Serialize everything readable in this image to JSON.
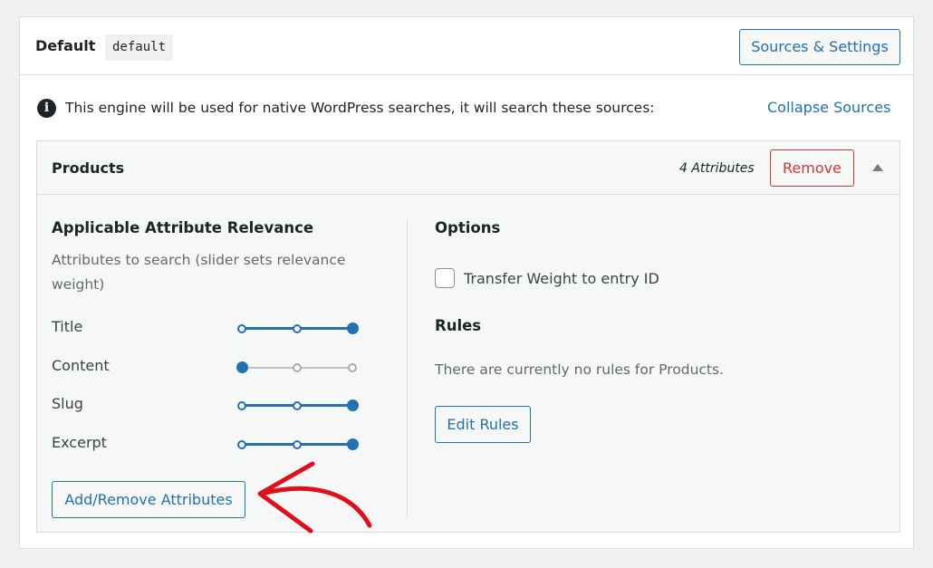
{
  "engine": {
    "name": "Default",
    "slug": "default",
    "sources_button": "Sources & Settings",
    "notice": "This engine will be used for native WordPress searches, it will search these sources:",
    "collapse_link": "Collapse Sources"
  },
  "source": {
    "name": "Products",
    "attribute_count": "4 Attributes",
    "remove_button": "Remove",
    "relevance": {
      "title": "Applicable Attribute Relevance",
      "description": "Attributes to search (slider sets relevance weight)",
      "attributes": [
        {
          "label": "Title",
          "weight_level": 3,
          "max_level": 3
        },
        {
          "label": "Content",
          "weight_level": 1,
          "max_level": 3
        },
        {
          "label": "Slug",
          "weight_level": 3,
          "max_level": 3
        },
        {
          "label": "Excerpt",
          "weight_level": 3,
          "max_level": 3
        }
      ],
      "add_remove_button": "Add/Remove Attributes"
    },
    "options": {
      "title": "Options",
      "transfer_weight_label": "Transfer Weight to entry ID",
      "transfer_weight_checked": false
    },
    "rules": {
      "title": "Rules",
      "empty_text": "There are currently no rules for Products.",
      "edit_button": "Edit Rules"
    }
  },
  "colors": {
    "accent": "#2271b1",
    "danger": "#d63638",
    "annotation": "#e0101a"
  },
  "icons": [
    "info-icon",
    "collapse-arrow-icon",
    "annotation-arrow-icon"
  ]
}
